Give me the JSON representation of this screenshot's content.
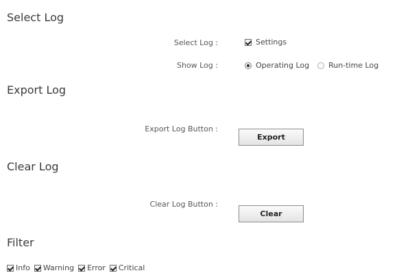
{
  "select_log": {
    "title": "Select Log",
    "select_label": "Select Log :",
    "select_option": "Settings",
    "select_checked": true,
    "show_label": "Show Log :",
    "show_options": [
      {
        "label": "Operating Log",
        "selected": true
      },
      {
        "label": "Run-time Log",
        "selected": false
      }
    ]
  },
  "export_log": {
    "title": "Export Log",
    "button_label_text": "Export Log Button :",
    "button": "Export"
  },
  "clear_log": {
    "title": "Clear Log",
    "button_label_text": "Clear Log Button :",
    "button": "Clear"
  },
  "filter": {
    "title": "Filter",
    "items": [
      {
        "label": "Info",
        "checked": true
      },
      {
        "label": "Warning",
        "checked": true
      },
      {
        "label": "Error",
        "checked": true
      },
      {
        "label": "Critical",
        "checked": true
      }
    ]
  }
}
